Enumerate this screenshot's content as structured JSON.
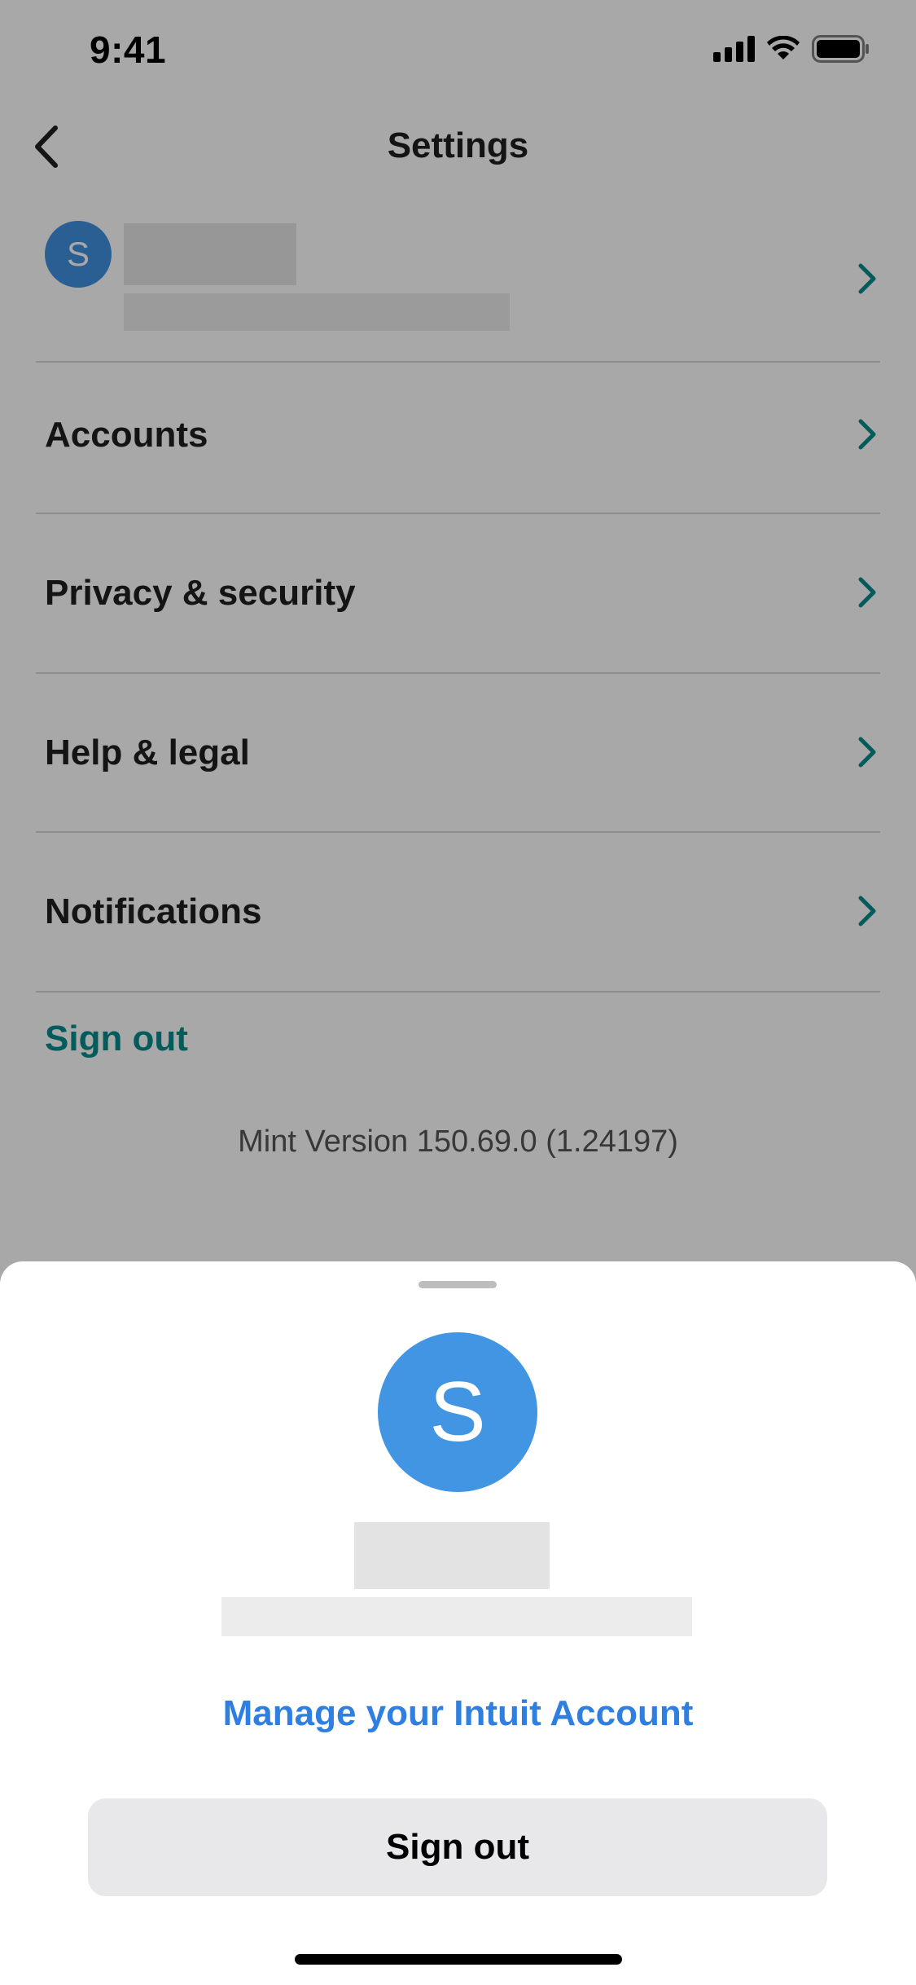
{
  "status_bar": {
    "time": "9:41"
  },
  "nav": {
    "title": "Settings"
  },
  "profile": {
    "avatar_letter": "S"
  },
  "menu": [
    {
      "label": "Accounts"
    },
    {
      "label": "Privacy & security"
    },
    {
      "label": "Help & legal"
    },
    {
      "label": "Notifications"
    }
  ],
  "sign_out_link": "Sign out",
  "version": "Mint Version 150.69.0 (1.24197)",
  "sheet": {
    "avatar_letter": "S",
    "manage_link": "Manage your Intuit Account",
    "sign_out_button": "Sign out"
  },
  "colors": {
    "accent_teal": "#078a8a",
    "avatar_blue": "#4295e2",
    "link_blue": "#2f7fe0",
    "button_gray": "#e8e8ea"
  },
  "icons": [
    "cellular-signal-icon",
    "wifi-icon",
    "battery-icon",
    "back-chevron-icon",
    "chevron-right-icon"
  ]
}
